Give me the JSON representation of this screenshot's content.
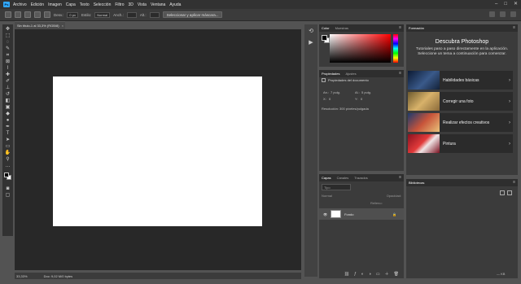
{
  "menu": {
    "logo": "Ps",
    "items": [
      "Archivo",
      "Edición",
      "Imagen",
      "Capa",
      "Texto",
      "Selección",
      "Filtro",
      "3D",
      "Vista",
      "Ventana",
      "Ayuda"
    ]
  },
  "options": {
    "feather_label": "Desv.:",
    "feather_value": "0 px",
    "style_label": "Estilo:",
    "style_value": "Normal",
    "width_label": "Anch.:",
    "height_label": "Alt.:",
    "select_mask_button": "Seleccionar y aplicar máscara..."
  },
  "document": {
    "tab_title": "Sin título-1 al 33,3% (RGB/8)",
    "zoom": "33,33%",
    "doc_info": "Doc: 9,02 M/0 bytes",
    "canvas_color": "#ffffff"
  },
  "color_panel": {
    "tabs": [
      "Color",
      "Muestras"
    ],
    "hue": "#ff0000"
  },
  "properties_panel": {
    "tabs": [
      "Propiedades",
      "Ajustes"
    ],
    "doc_label": "Propiedades del documento",
    "w_label": "An.:",
    "w_value": "7 pulg.",
    "h_label": "Al.:",
    "h_value": "5 pulg.",
    "x_label": "X:",
    "x_value": "0",
    "y_label": "Y:",
    "y_value": "0",
    "resolution": "Resolución: 300 píxeles/pulgada"
  },
  "layers_panel": {
    "tabs": [
      "Capas",
      "Canales",
      "Trazados"
    ],
    "search_placeholder": "Tipo",
    "blend_mode": "Normal",
    "opacity_label": "Opacidad:",
    "fill_label": "Relleno:",
    "layer_name": "Fondo"
  },
  "learn_panel": {
    "tab": "Formación",
    "title": "Descubra Photoshop",
    "subtitle": "Tutoriales paso a paso directamente en la aplicación. Seleccione un tema a continuación para comenzar.",
    "cards": [
      {
        "label": "Habilidades básicas"
      },
      {
        "label": "Corregir una foto"
      },
      {
        "label": "Realizar efectos creativos"
      },
      {
        "label": "Pintura"
      }
    ]
  },
  "libraries_panel": {
    "tab": "Bibliotecas",
    "footer": "— KB"
  }
}
